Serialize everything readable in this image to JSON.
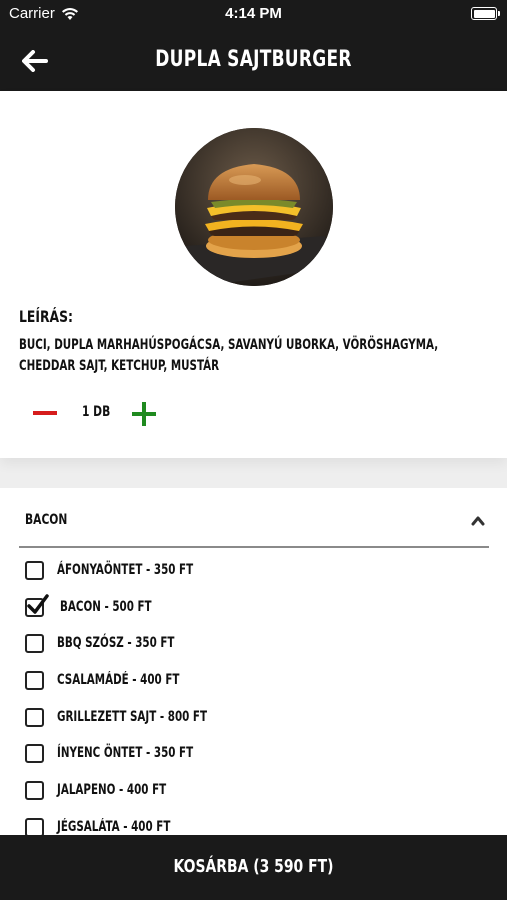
{
  "status": {
    "carrier": "Carrier",
    "time": "4:14 PM"
  },
  "header": {
    "title": "DUPLA SAJTBURGER"
  },
  "product": {
    "description_label": "LEÍRÁS:",
    "description": "BUCI, DUPLA MARHAHÚSPOGÁCSA, SAVANYÚ UBORKA, VÖRÖSHAGYMA, CHEDDAR SAJT, KETCHUP, MUSTÁR",
    "quantity": "1 DB"
  },
  "extras": {
    "title": "BACON",
    "options": [
      {
        "label": "ÁFONYAÖNTET - 350 FT",
        "checked": false
      },
      {
        "label": "BACON - 500 FT",
        "checked": true
      },
      {
        "label": "BBQ SZÓSZ - 350 FT",
        "checked": false
      },
      {
        "label": "CSALAMÁDÉ - 400 FT",
        "checked": false
      },
      {
        "label": "GRILLEZETT SAJT - 800 FT",
        "checked": false
      },
      {
        "label": "ÍNYENC ÖNTET - 350 FT",
        "checked": false
      },
      {
        "label": "JALAPENO - 400 FT",
        "checked": false
      },
      {
        "label": "JÉGSALÁTA - 400 FT",
        "checked": false
      }
    ]
  },
  "cart": {
    "label": "KOSÁRBA (3 590 FT)"
  },
  "colors": {
    "dark": "#1a1a1a",
    "minus": "#d61c1c",
    "plus": "#1f8a1f"
  }
}
